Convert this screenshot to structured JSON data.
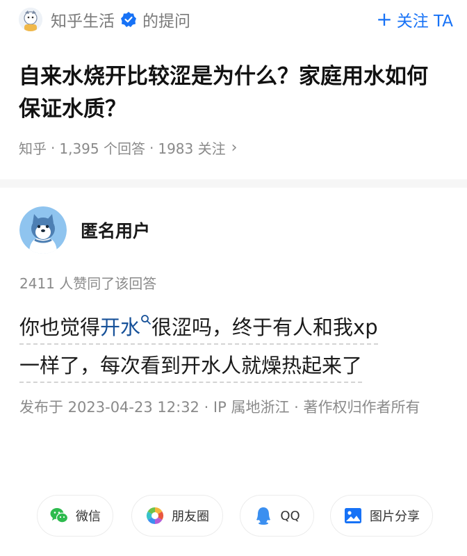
{
  "question": {
    "asker": {
      "name": "知乎生活",
      "suffix": "的提问"
    },
    "follow_label": "关注 TA",
    "title": "自来水烧开比较涩是为什么？家庭用水如何保证水质？",
    "meta": {
      "source": "知乎",
      "answers": "1,395 个回答",
      "followers": "1983 关注"
    }
  },
  "answer": {
    "author": "匿名用户",
    "votes": "2411 人赞同了该回答",
    "body": {
      "line1_before": "你也觉得",
      "keyword": "开水",
      "line1_after": "很涩吗，终于有人和我xp",
      "line2": "一样了，每次看到开水人就燥热起来了"
    },
    "published": "发布于 2023-04-23 12:32 · IP 属地浙江 · 著作权归作者所有"
  },
  "share": [
    {
      "label": "微信",
      "icon": "wechat-icon",
      "color": "#2dbb4e"
    },
    {
      "label": "朋友圈",
      "icon": "moments-icon"
    },
    {
      "label": "QQ",
      "icon": "qq-icon",
      "color": "#3b8ff0"
    },
    {
      "label": "图片分享",
      "icon": "image-share-icon",
      "color": "#1772f6"
    }
  ],
  "colors": {
    "accent": "#1772f6",
    "keyword": "#175199",
    "muted": "#8a8a8a"
  }
}
